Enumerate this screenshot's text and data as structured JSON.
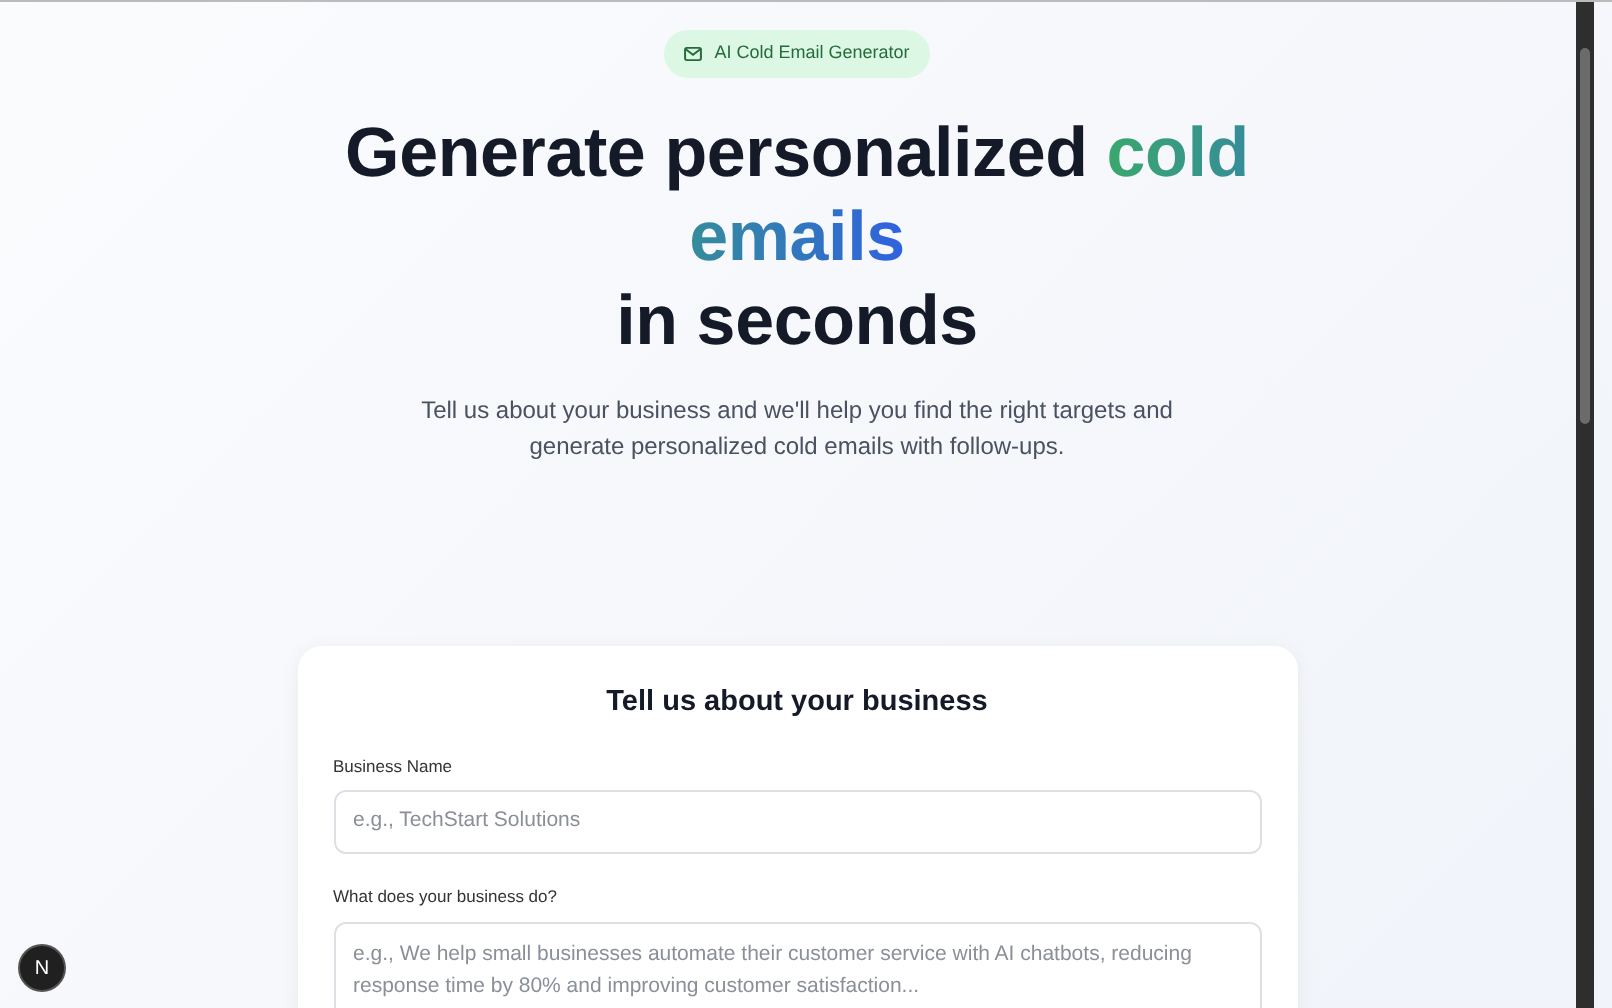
{
  "badge": {
    "label": "AI Cold Email Generator"
  },
  "headline": {
    "before": "Generate personalized",
    "highlight": "cold emails",
    "after": "in seconds"
  },
  "subtitle": "Tell us about your business and we'll help you find the right targets and generate personalized cold emails with follow-ups.",
  "form": {
    "title": "Tell us about your business",
    "fields": [
      {
        "kind": "input",
        "label": "Business Name",
        "placeholder": "e.g., TechStart Solutions"
      },
      {
        "kind": "textarea",
        "label": "What does your business do?",
        "placeholder": "e.g., We help small businesses automate their customer service with AI chatbots, reducing response time by 80% and improving customer satisfaction..."
      }
    ]
  },
  "dev_badge": "N"
}
